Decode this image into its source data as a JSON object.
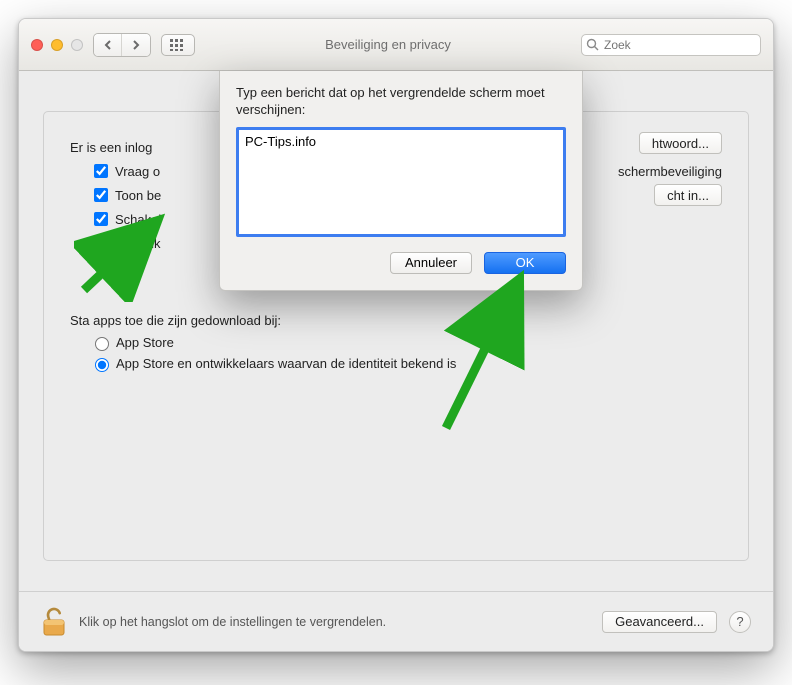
{
  "window": {
    "title": "Beveiliging en privacy"
  },
  "toolbar": {
    "search_placeholder": "Zoek"
  },
  "main": {
    "login_heading": "Er is een inlog",
    "btn_change_password": "htwoord...",
    "checks": {
      "c1": "Vraag o",
      "c1_tail": "schermbeveiliging",
      "c2": "Toon be",
      "c2_btn": "cht in...",
      "c3": "Schakel",
      "c4": "Gebruik"
    },
    "downloads_heading": "Sta apps toe die zijn gedownload bij:",
    "radio1": "App Store",
    "radio2": "App Store en ontwikkelaars waarvan de identiteit bekend is"
  },
  "footer": {
    "lock_text": "Klik op het hangslot om de instellingen te vergrendelen.",
    "advanced": "Geavanceerd..."
  },
  "sheet": {
    "prompt": "Typ een bericht dat op het vergrendelde scherm moet verschijnen:",
    "value": "PC-Tips.info",
    "cancel": "Annuleer",
    "ok": "OK"
  },
  "help_label": "?"
}
